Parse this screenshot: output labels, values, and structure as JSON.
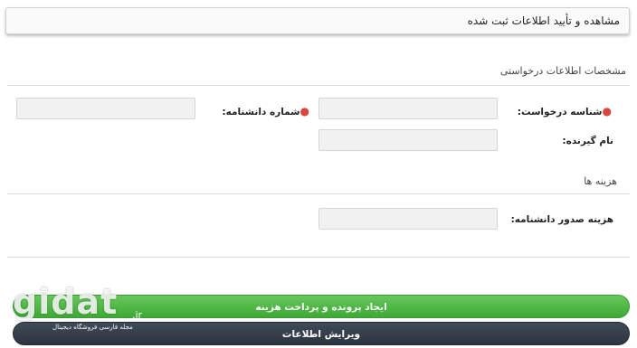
{
  "header": {
    "title": "مشاهده و تأیید اطلاعات ثبت شده"
  },
  "request_section": {
    "title": "مشخصات اطلاعات درخواستی",
    "fields": [
      {
        "label": "شناسه درخواست:",
        "required": true,
        "value": ""
      },
      {
        "label": "شماره دانشنامه:",
        "required": true,
        "value": ""
      },
      {
        "label": "نام گیرنده:",
        "required": false,
        "value": ""
      }
    ]
  },
  "cost_section": {
    "title": "هزینه ها",
    "fields": [
      {
        "label": "هزینه صدور دانشنامه:",
        "required": false,
        "value": ""
      }
    ]
  },
  "buttons": {
    "create_pay": "ایجاد پرونده و پرداخت هزینه",
    "edit": "ویرایش اطلاعات"
  },
  "watermark": {
    "logo": "gidat",
    "tld": ".ir",
    "tagline": "مجله فارسی فروشگاه دیجیتال"
  },
  "colors": {
    "required_dot": "#d9453b",
    "primary_button": "#4cb842",
    "secondary_button": "#333b47"
  }
}
